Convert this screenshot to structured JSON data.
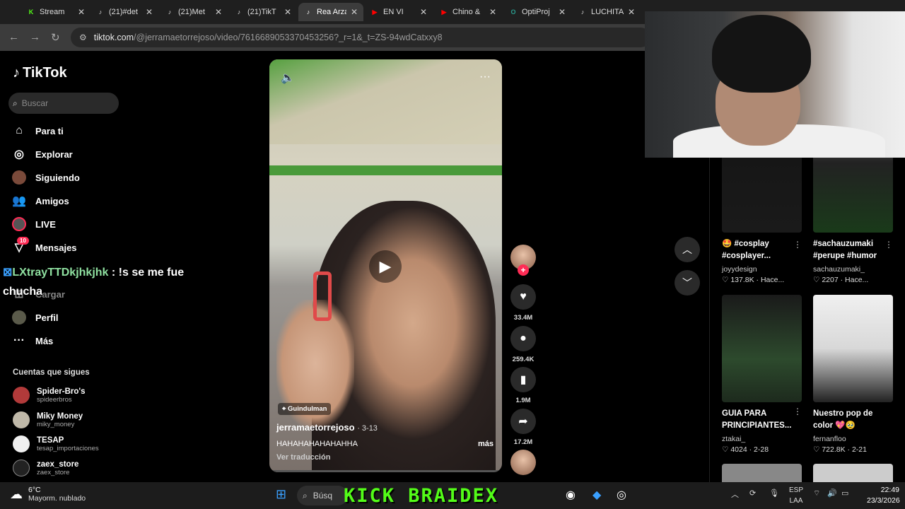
{
  "browser": {
    "tabs": [
      {
        "title": "Stream",
        "fav": "K",
        "color": "#53fc18",
        "active": false
      },
      {
        "title": "(21)#det",
        "fav": "♪",
        "color": "#000000",
        "active": false
      },
      {
        "title": "(21)Met",
        "fav": "♪",
        "color": "#000000",
        "active": false
      },
      {
        "title": "(21)TikT",
        "fav": "♪",
        "color": "#000000",
        "active": false
      },
      {
        "title": "Rea Arza",
        "fav": "♪",
        "color": "#000000",
        "active": true
      },
      {
        "title": "EN VI",
        "fav": "▶",
        "color": "#ff0000",
        "active": false
      },
      {
        "title": "Chino &",
        "fav": "▶",
        "color": "#ff0000",
        "active": false
      },
      {
        "title": "OptiProj",
        "fav": "O",
        "color": "#2a9d8f",
        "active": false
      },
      {
        "title": "LUCHITA",
        "fav": "♪",
        "color": "#000000",
        "active": false
      }
    ],
    "url_host": "tiktok.com",
    "url_path": "/@jerramaetorrejoso/video/7616689053370453256?_r=1&_t=ZS-94wdCatxxy8"
  },
  "sidebar": {
    "logo": "TikTok",
    "search_placeholder": "Buscar",
    "nav": [
      {
        "label": "Para ti",
        "icon": "home-icon"
      },
      {
        "label": "Explorar",
        "icon": "compass-icon"
      },
      {
        "label": "Siguiendo",
        "icon": "following-icon"
      },
      {
        "label": "Amigos",
        "icon": "friends-icon"
      },
      {
        "label": "LIVE",
        "icon": "live-icon"
      },
      {
        "label": "Mensajes",
        "icon": "messages-icon",
        "badge": "10"
      },
      {
        "label": "Cargar",
        "icon": "upload-icon"
      },
      {
        "label": "Perfil",
        "icon": "profile-icon"
      },
      {
        "label": "Más",
        "icon": "more-icon"
      }
    ],
    "following_title": "Cuentas que sigues",
    "following": [
      {
        "name": "Spider-Bro's",
        "handle": "spideerbros"
      },
      {
        "name": "Miky Money",
        "handle": "miky_money"
      },
      {
        "name": "TESAP",
        "handle": "tesap_importaciones"
      },
      {
        "name": "zaex_store",
        "handle": "zaex_store"
      }
    ]
  },
  "chat": {
    "user": "LXtrayTTDkjhkjhk",
    "message": ": !s se me fue chucha"
  },
  "video": {
    "tag": "Guindulman",
    "author": "jerramaetorrejoso",
    "date": "· 3-13",
    "caption": "HAHAHAHAHAHAHHA",
    "more": "más",
    "translate": "Ver traducción",
    "actions": {
      "likes": "33.4M",
      "comments": "259.4K",
      "saves": "1.9M",
      "shares": "17.2M"
    }
  },
  "related": [
    {
      "title": "🤩 #cosplay #cosplayer...",
      "author": "joyydesign",
      "stats": "♡ 137.8K · Hace..."
    },
    {
      "title": "#sachauzumaki #perupe #humor",
      "author": "sachauzumaki_",
      "stats": "♡ 2207 · Hace..."
    },
    {
      "title": "GUIA PARA PRINCIPIANTES...",
      "author": "ztakai_",
      "stats": "♡ 4024 · 2-28"
    },
    {
      "title": "Nuestro pop de color 💖🥹",
      "author": "fernanfloo",
      "stats": "♡ 722.8K · 2-21"
    }
  ],
  "taskbar": {
    "temp": "6°C",
    "weather": "Mayorm. nublado",
    "search": "Búsq",
    "overlay": "KICK BRAIDEX",
    "lang1": "ESP",
    "lang2": "LAA",
    "time": "22:49",
    "date": "23/3/2026"
  }
}
